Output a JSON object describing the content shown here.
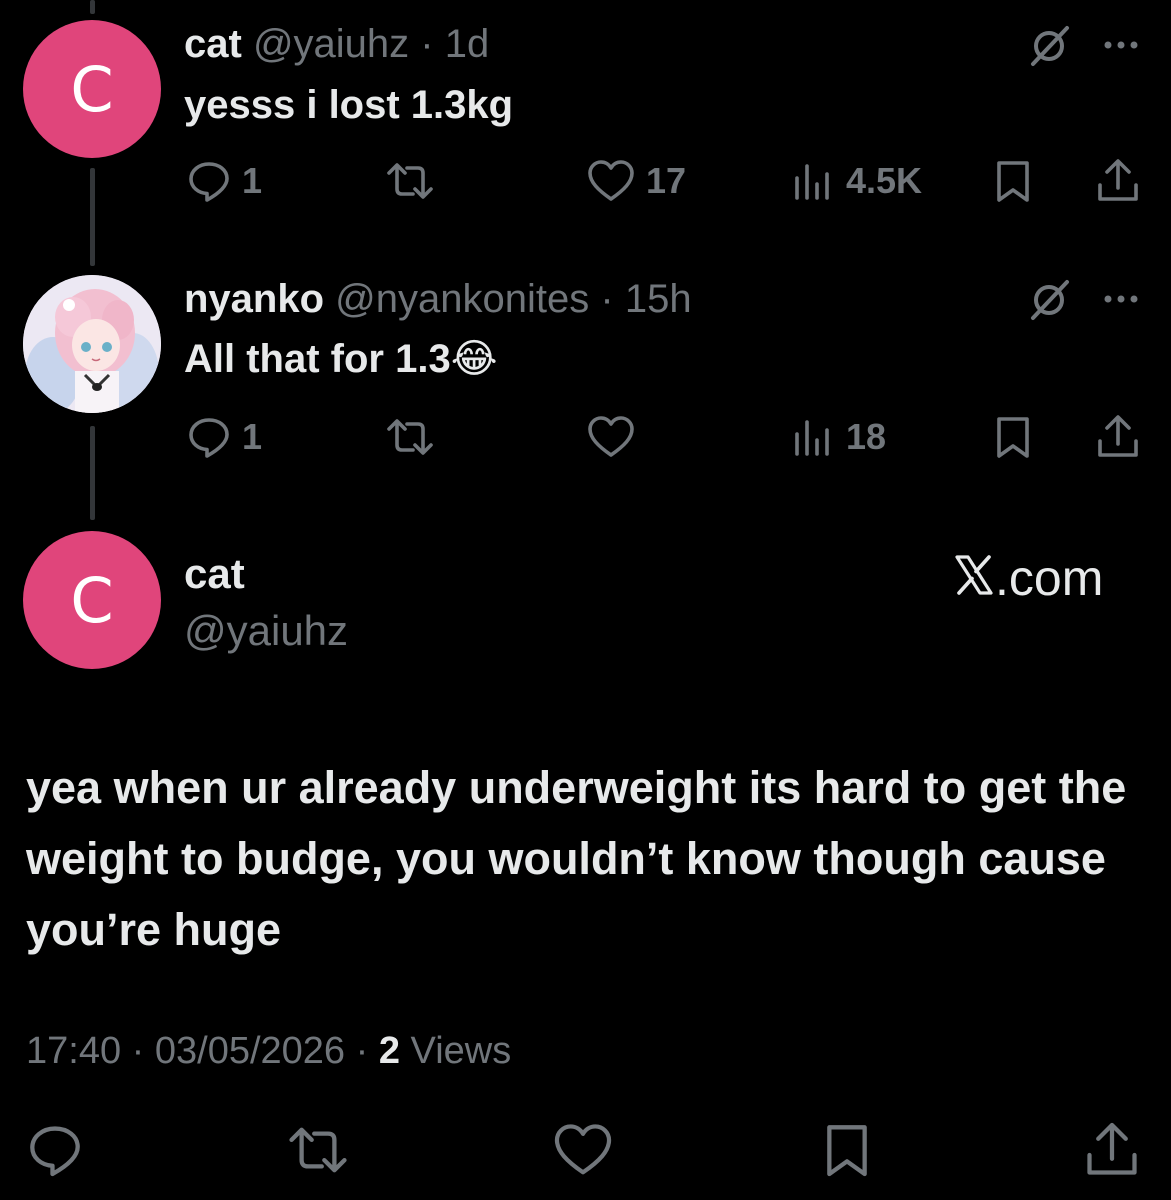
{
  "reply1": {
    "avatar_letter": "C",
    "name": "cat",
    "handle": "@yaiuhz",
    "separator": "·",
    "time": "1d",
    "text": "yesss i lost 1.3kg",
    "replies": "1",
    "retweets": "",
    "likes": "17",
    "views": "4.5K"
  },
  "reply2": {
    "name": "nyanko",
    "handle": "@nyankonites",
    "separator": "·",
    "time": "15h",
    "text": "All that for 1.3",
    "emoji": "😂",
    "replies": "1",
    "retweets": "",
    "likes": "",
    "views": "18"
  },
  "main": {
    "avatar_letter": "C",
    "name": "cat",
    "handle": "@yaiuhz",
    "site": ".com",
    "text": "yea when ur already underweight its hard to get the weight to budge, you wouldn’t know though cause you’re huge",
    "time": "17:40",
    "separator": "·",
    "date": "03/05/2026",
    "views_count": "2",
    "views_label": "Views"
  },
  "colors": {
    "background": "#000000",
    "text_primary": "#e7e9ea",
    "text_secondary": "#71767b",
    "avatar_pink": "#e0457b"
  },
  "icons": [
    "reply-icon",
    "retweet-icon",
    "like-icon",
    "views-icon",
    "bookmark-icon",
    "share-icon",
    "grok-icon",
    "more-icon",
    "x-logo"
  ]
}
